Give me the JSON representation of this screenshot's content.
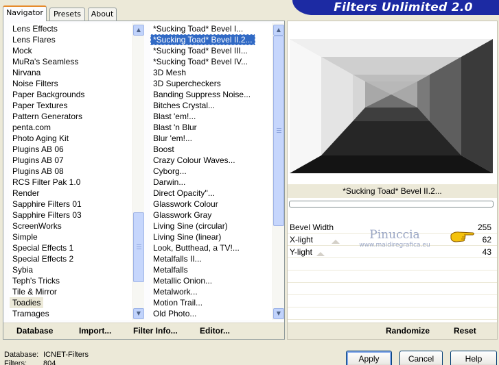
{
  "tabs": {
    "navigator": "Navigator",
    "presets": "Presets",
    "about": "About"
  },
  "banner": "Filters Unlimited 2.0",
  "categories": [
    "Lens Effects",
    "Lens Flares",
    "Mock",
    "MuRa's Seamless",
    "Nirvana",
    "Noise Filters",
    "Paper Backgrounds",
    "Paper Textures",
    "Pattern Generators",
    "penta.com",
    "Photo Aging Kit",
    "Plugins AB 06",
    "Plugins AB 07",
    "Plugins AB 08",
    "RCS Filter Pak 1.0",
    "Render",
    "Sapphire Filters 01",
    "Sapphire Filters 03",
    "ScreenWorks",
    "Simple",
    "Special Effects 1",
    "Special Effects 2",
    "Sybia",
    "Teph's Tricks",
    "Tile & Mirror",
    "Toadies",
    "Tramages"
  ],
  "selected_category": "Toadies",
  "filters": [
    "*Sucking Toad*  Bevel I...",
    "*Sucking Toad*  Bevel II.2...",
    "*Sucking Toad*  Bevel III...",
    "*Sucking Toad*  Bevel IV...",
    "3D Mesh",
    "3D Supercheckers",
    "Banding Suppress Noise...",
    "Bitches Crystal...",
    "Blast 'em!...",
    "Blast 'n Blur",
    "Blur 'em!...",
    "Boost",
    "Crazy Colour Waves...",
    "Cyborg...",
    "Darwin...",
    "Direct Opacity''...",
    "Glasswork Colour",
    "Glasswork Gray",
    "Living Sine (circular)",
    "Living Sine (linear)",
    "Look, Butthead, a TV!...",
    "Metalfalls II...",
    "Metalfalls",
    "Metallic Onion...",
    "Metalwork...",
    "Motion Trail...",
    "Old Photo..."
  ],
  "selected_filter": "*Sucking Toad*  Bevel II.2...",
  "left_buttons": {
    "database": "Database",
    "import": "Import...",
    "filter_info": "Filter Info...",
    "editor": "Editor..."
  },
  "current_filter_title": "*Sucking Toad*  Bevel II.2...",
  "params": [
    {
      "label": "Bevel Width",
      "value": "255"
    },
    {
      "label": "X-light",
      "value": "62"
    },
    {
      "label": "Y-light",
      "value": "43"
    }
  ],
  "watermark": {
    "line1": "Pinuccia",
    "line2": "www.maidiregrafica.eu"
  },
  "right_buttons": {
    "randomize": "Randomize",
    "reset": "Reset"
  },
  "footer": {
    "database_label": "Database:",
    "database_value": "ICNET-Filters",
    "filters_label": "Filters:",
    "filters_value": "804"
  },
  "dialog_buttons": {
    "apply": "Apply",
    "cancel": "Cancel",
    "help": "Help"
  },
  "icons": {
    "hand": "pointing-hand-icon",
    "up": "arrow-up-icon",
    "down": "arrow-down-icon"
  },
  "colors": {
    "banner": "#1c2aa3",
    "selection": "#316ac5",
    "tab_accent": "#e68b2c"
  }
}
